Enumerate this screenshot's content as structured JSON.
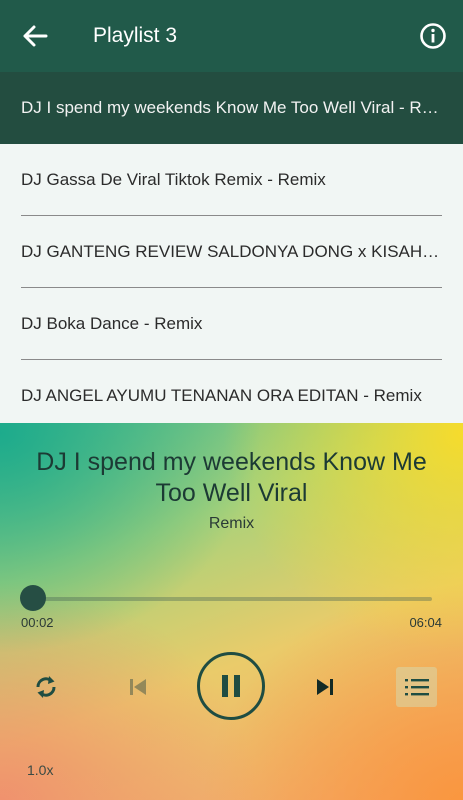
{
  "appbar": {
    "title": "Playlist 3"
  },
  "playlist": [
    {
      "label": "DJ I spend my weekends Know Me Too Well Viral - Remix",
      "active": true
    },
    {
      "label": "DJ Gassa De Viral Tiktok Remix - Remix",
      "active": false
    },
    {
      "label": "DJ GANTENG REVIEW SALDONYA DONG x KISAH - Remix",
      "active": false
    },
    {
      "label": "DJ Boka Dance - Remix",
      "active": false
    },
    {
      "label": "DJ ANGEL AYUMU TENANAN ORA EDITAN - Remix",
      "active": false
    }
  ],
  "player": {
    "title": "DJ I spend my weekends Know Me Too Well Viral",
    "subtitle": "Remix",
    "current_time": "00:02",
    "total_time": "06:04",
    "progress": 0.005,
    "speed": "1.0x"
  },
  "icons": {
    "back": "arrow-left-icon",
    "info": "info-icon",
    "repeat": "repeat-icon",
    "prev": "skip-previous-icon",
    "play_pause": "pause-icon",
    "next": "skip-next-icon",
    "queue": "queue-list-icon"
  },
  "colors": {
    "appbar": "#215a4a",
    "active_row": "#234d40",
    "accent": "#264e44"
  }
}
